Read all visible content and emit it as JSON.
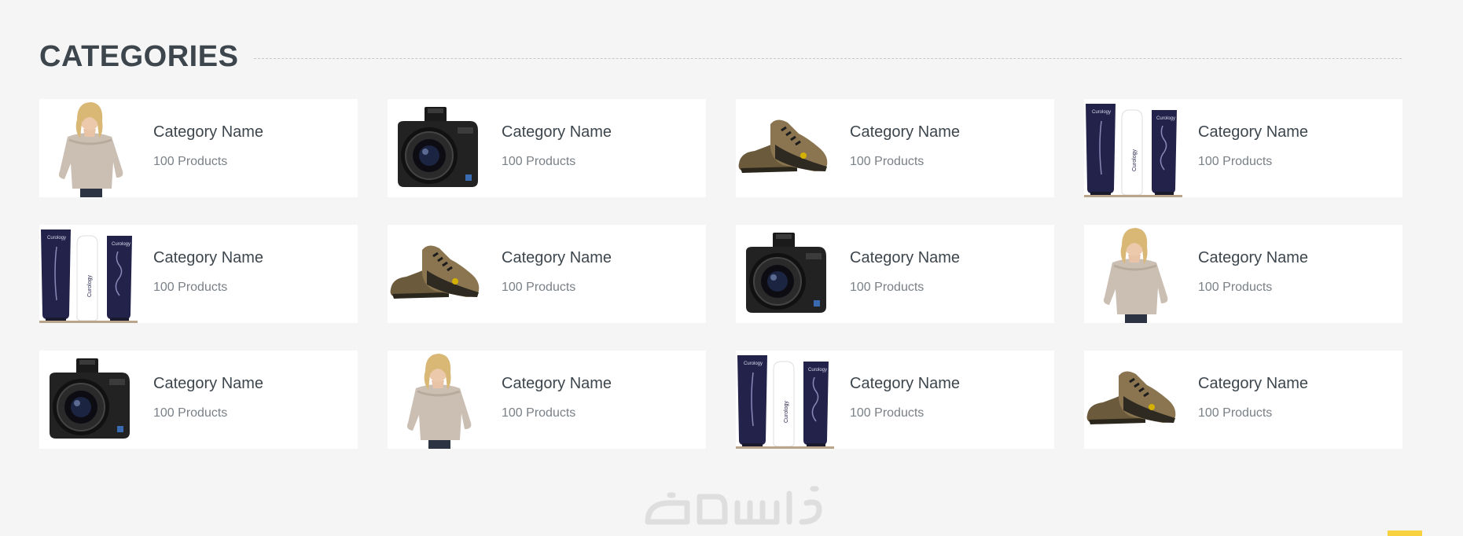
{
  "section": {
    "title": "CATEGORIES"
  },
  "categories": [
    {
      "name": "Category Name",
      "count": "100 Products",
      "image": "woman-in-sweater"
    },
    {
      "name": "Category Name",
      "count": "100 Products",
      "image": "dslr-camera"
    },
    {
      "name": "Category Name",
      "count": "100 Products",
      "image": "hiking-shoes"
    },
    {
      "name": "Category Name",
      "count": "100 Products",
      "image": "cosmetic-tubes"
    },
    {
      "name": "Category Name",
      "count": "100 Products",
      "image": "cosmetic-tubes"
    },
    {
      "name": "Category Name",
      "count": "100 Products",
      "image": "hiking-shoes"
    },
    {
      "name": "Category Name",
      "count": "100 Products",
      "image": "dslr-camera"
    },
    {
      "name": "Category Name",
      "count": "100 Products",
      "image": "woman-in-sweater"
    },
    {
      "name": "Category Name",
      "count": "100 Products",
      "image": "dslr-camera"
    },
    {
      "name": "Category Name",
      "count": "100 Products",
      "image": "woman-in-sweater"
    },
    {
      "name": "Category Name",
      "count": "100 Products",
      "image": "cosmetic-tubes"
    },
    {
      "name": "Category Name",
      "count": "100 Products",
      "image": "hiking-shoes"
    }
  ],
  "watermark": {
    "text": "خمسات"
  },
  "colors": {
    "background": "#f5f5f5",
    "card": "#ffffff",
    "title": "#3d464d",
    "muted": "#7a8087",
    "accent": "#f7d23e"
  }
}
